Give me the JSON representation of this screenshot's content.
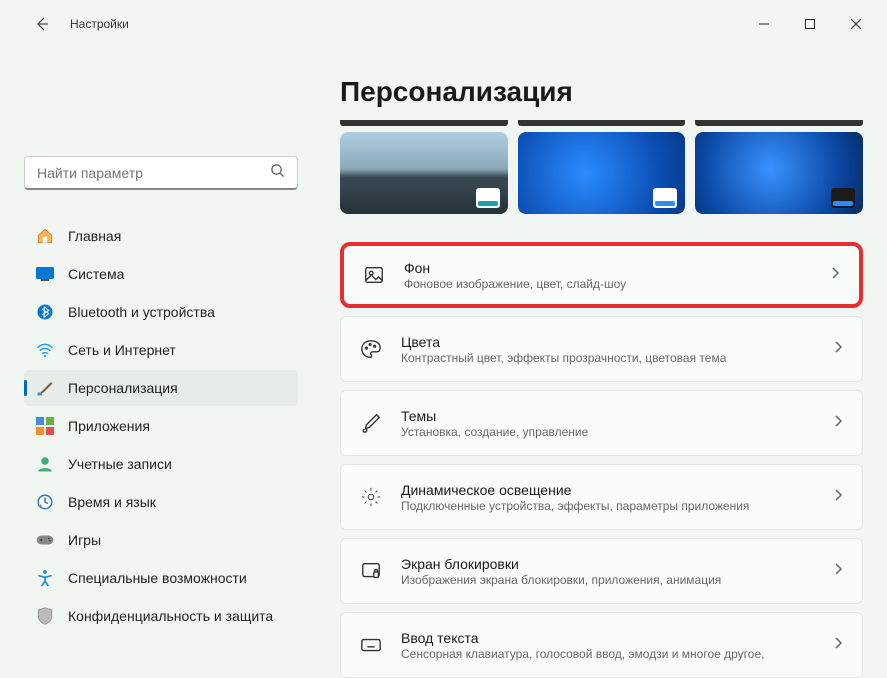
{
  "window": {
    "title": "Настройки"
  },
  "search": {
    "placeholder": "Найти параметр"
  },
  "sidebar": {
    "items": [
      {
        "id": "home",
        "label": "Главная"
      },
      {
        "id": "system",
        "label": "Система"
      },
      {
        "id": "bluetooth",
        "label": "Bluetooth и устройства"
      },
      {
        "id": "network",
        "label": "Сеть и Интернет"
      },
      {
        "id": "personalization",
        "label": "Персонализация"
      },
      {
        "id": "apps",
        "label": "Приложения"
      },
      {
        "id": "accounts",
        "label": "Учетные записи"
      },
      {
        "id": "time",
        "label": "Время и язык"
      },
      {
        "id": "gaming",
        "label": "Игры"
      },
      {
        "id": "accessibility",
        "label": "Специальные возможности"
      },
      {
        "id": "privacy",
        "label": "Конфиденциальность и защита"
      }
    ]
  },
  "page": {
    "heading": "Персонализация"
  },
  "settings": [
    {
      "id": "background",
      "title": "Фон",
      "desc": "Фоновое изображение, цвет, слайд-шоу",
      "highlighted": true
    },
    {
      "id": "colors",
      "title": "Цвета",
      "desc": "Контрастный цвет, эффекты прозрачности, цветовая тема"
    },
    {
      "id": "themes",
      "title": "Темы",
      "desc": "Установка, создание, управление"
    },
    {
      "id": "dynamiclight",
      "title": "Динамическое освещение",
      "desc": "Подключенные устройства, эффекты, параметры приложения"
    },
    {
      "id": "lockscreen",
      "title": "Экран блокировки",
      "desc": "Изображения экрана блокировки, приложения, анимация"
    },
    {
      "id": "textinput",
      "title": "Ввод текста",
      "desc": "Сенсорная клавиатура, голосовой ввод, эмодзи и многое другое,"
    }
  ]
}
